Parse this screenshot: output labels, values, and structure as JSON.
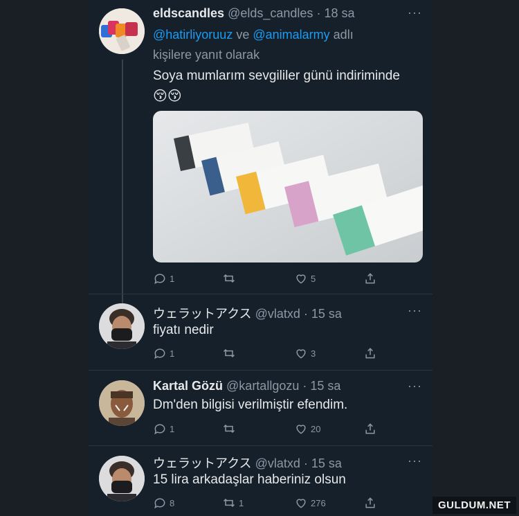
{
  "tweets": [
    {
      "name": "eldscandles",
      "handle": "@elds_candles",
      "time": "18 sa",
      "reply_line1": {
        "mention1": "@hatirliyoruuz",
        "joiner": "ve",
        "mention2": "@animalarmy",
        "suffix": "adlı"
      },
      "reply_line2": "kişilere yanıt olarak",
      "text": "Soya mumlarım sevgililer günü indiriminde",
      "emojis": "😚😚",
      "counts": {
        "reply": "1",
        "retweet": "",
        "like": "5"
      }
    },
    {
      "name": "ウェラットアクス",
      "handle": "@vlatxd",
      "time": "15 sa",
      "text": "fiyatı nedir",
      "counts": {
        "reply": "1",
        "retweet": "",
        "like": "3"
      }
    },
    {
      "name": "Kartal Gözü",
      "handle": "@kartallgozu",
      "time": "15 sa",
      "text": "Dm'den bilgisi verilmiştir efendim.",
      "counts": {
        "reply": "1",
        "retweet": "",
        "like": "20"
      }
    },
    {
      "name": "ウェラットアクス",
      "handle": "@vlatxd",
      "time": "15 sa",
      "text": "15 lira arkadaşlar haberiniz olsun",
      "counts": {
        "reply": "8",
        "retweet": "1",
        "like": "276"
      }
    }
  ],
  "more_label": "···",
  "watermark": "GULDUM.NET",
  "colors": {
    "background": "#15202b",
    "accent": "#1d9bf0",
    "muted": "#8b98a5"
  }
}
